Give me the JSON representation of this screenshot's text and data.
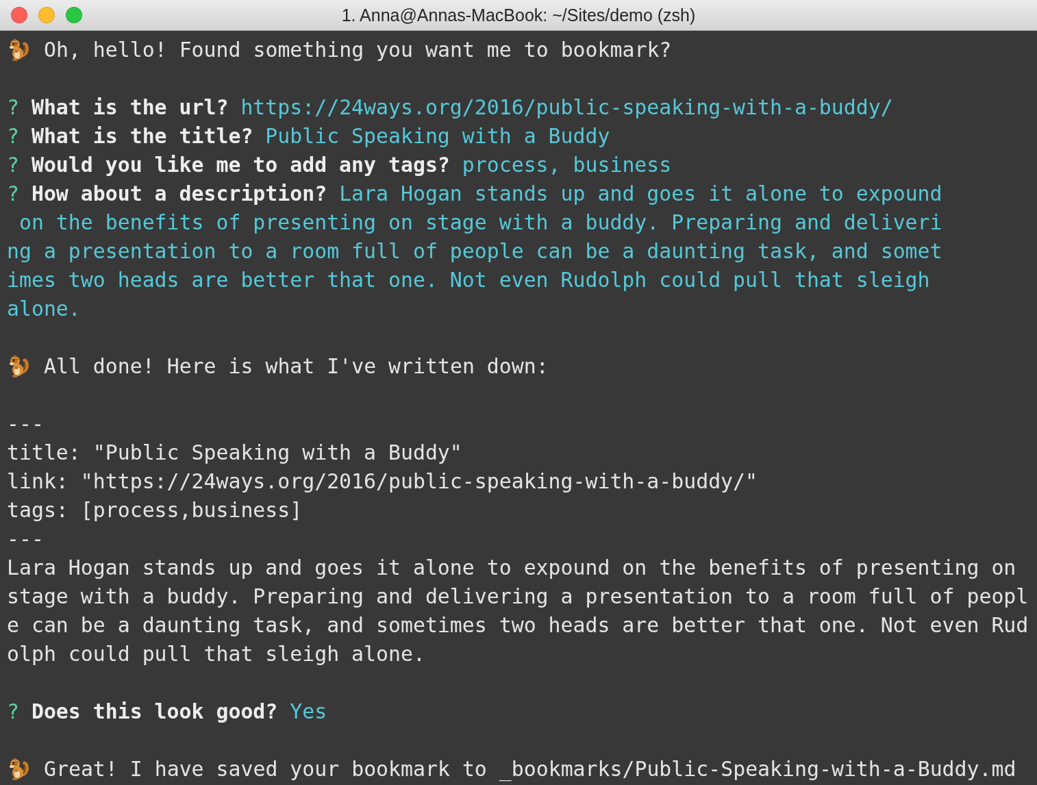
{
  "window": {
    "title": "1. Anna@Annas-MacBook: ~/Sites/demo (zsh)"
  },
  "lines": [
    {
      "kind": "message",
      "text": "Oh, hello! Found something you want me to bookmark?"
    },
    {
      "kind": "blank"
    },
    {
      "kind": "question",
      "mark": "?",
      "question": "What is the url?",
      "answer": "https://24ways.org/2016/public-speaking-with-a-buddy/"
    },
    {
      "kind": "question",
      "mark": "?",
      "question": "What is the title?",
      "answer": "Public Speaking with a Buddy"
    },
    {
      "kind": "question",
      "mark": "?",
      "question": "Would you like me to add any tags?",
      "answer": "process, business"
    },
    {
      "kind": "question",
      "mark": "?",
      "question": "How about a description?",
      "answer": "Lara Hogan stands up and goes it alone to expound"
    },
    {
      "kind": "answer",
      "text": " on the benefits of presenting on stage with a buddy. Preparing and deliveri"
    },
    {
      "kind": "answer",
      "text": "ng a presentation to a room full of people can be a daunting task, and somet"
    },
    {
      "kind": "answer",
      "text": "imes two heads are better that one. Not even Rudolph could pull that sleigh"
    },
    {
      "kind": "answer",
      "text": "alone."
    },
    {
      "kind": "blank"
    },
    {
      "kind": "message",
      "text": "All done! Here is what I've written down:"
    },
    {
      "kind": "blank"
    },
    {
      "kind": "output",
      "text": "---"
    },
    {
      "kind": "output",
      "text": "title: \"Public Speaking with a Buddy\""
    },
    {
      "kind": "output",
      "text": "link: \"https://24ways.org/2016/public-speaking-with-a-buddy/\""
    },
    {
      "kind": "output",
      "text": "tags: [process,business]"
    },
    {
      "kind": "output",
      "text": "---"
    },
    {
      "kind": "output",
      "text": "Lara Hogan stands up and goes it alone to expound on the benefits of presenting on"
    },
    {
      "kind": "output",
      "text": "stage with a buddy. Preparing and delivering a presentation to a room full of peopl"
    },
    {
      "kind": "output",
      "text": "e can be a daunting task, and sometimes two heads are better that one. Not even Rud"
    },
    {
      "kind": "output",
      "text": "olph could pull that sleigh alone."
    },
    {
      "kind": "blank"
    },
    {
      "kind": "question",
      "mark": "?",
      "question": "Does this look good?",
      "answer": "Yes"
    },
    {
      "kind": "blank"
    },
    {
      "kind": "message",
      "text": "Great! I have saved your bookmark to _bookmarks/Public-Speaking-with-a-Buddy.md"
    }
  ]
}
